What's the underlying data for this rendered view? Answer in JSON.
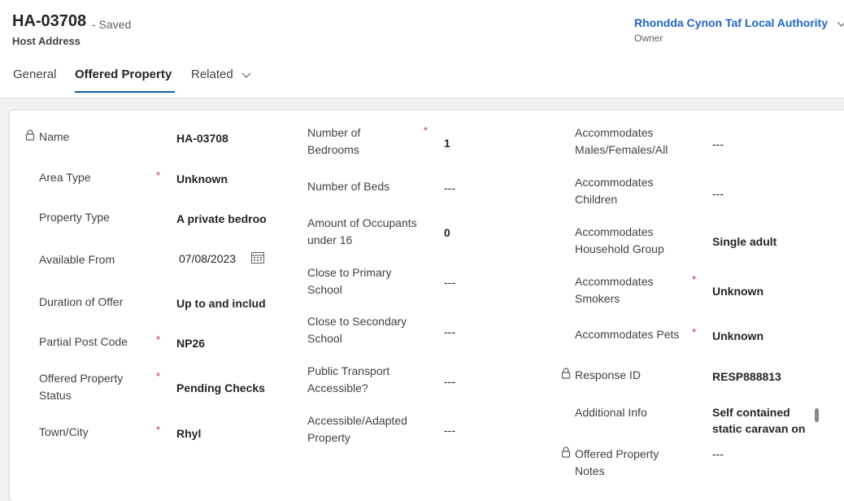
{
  "record": {
    "title": "HA-03708",
    "saved_status": "- Saved",
    "entity": "Host Address"
  },
  "owner": {
    "name": "Rhondda Cynon Taf Local Authority",
    "label": "Owner"
  },
  "tabs": [
    {
      "label": "General"
    },
    {
      "label": "Offered Property"
    },
    {
      "label": "Related"
    }
  ],
  "form": {
    "col1": [
      {
        "label": "Name",
        "value": "HA-03708"
      },
      {
        "label": "Area Type",
        "value": "Unknown"
      },
      {
        "label": "Property Type",
        "value": "A private bedroom"
      },
      {
        "label": "Available From",
        "value": "07/08/2023"
      },
      {
        "label": "Duration of Offer",
        "value": "Up to and including"
      },
      {
        "label": "Partial Post Code",
        "value": "NP26"
      },
      {
        "label": "Offered Property Status",
        "value": "Pending Checks"
      },
      {
        "label": "Town/City",
        "value": "Rhyl"
      }
    ],
    "col2": [
      {
        "label": "Number of Bedrooms",
        "value": "1"
      },
      {
        "label": "Number of Beds",
        "value": "---"
      },
      {
        "label": "Amount of Occupants under 16",
        "value": "0"
      },
      {
        "label": "Close to Primary School",
        "value": "---"
      },
      {
        "label": "Close to Secondary School",
        "value": "---"
      },
      {
        "label": "Public Transport Accessible?",
        "value": "---"
      },
      {
        "label": "Accessible/Adapted Property",
        "value": "---"
      }
    ],
    "col3": [
      {
        "label": "Accommodates Males/Females/All",
        "value": "---"
      },
      {
        "label": "Accommodates Children",
        "value": "---"
      },
      {
        "label": "Accommodates Household Group",
        "value": "Single adult"
      },
      {
        "label": "Accommodates Smokers",
        "value": "Unknown"
      },
      {
        "label": "Accommodates Pets",
        "value": "Unknown"
      },
      {
        "label": "Response ID",
        "value": "RESP888813"
      },
      {
        "label": "Additional Info",
        "value": "Self contained static caravan on"
      },
      {
        "label": "Offered Property Notes",
        "value": "---"
      }
    ],
    "required_marker": "*"
  },
  "colors": {
    "link": "#2266c3",
    "tab_underline": "#115ea3",
    "required": "#c4314b"
  },
  "icons": [
    "lock-icon",
    "calendar-icon",
    "chevron-down-icon"
  ]
}
